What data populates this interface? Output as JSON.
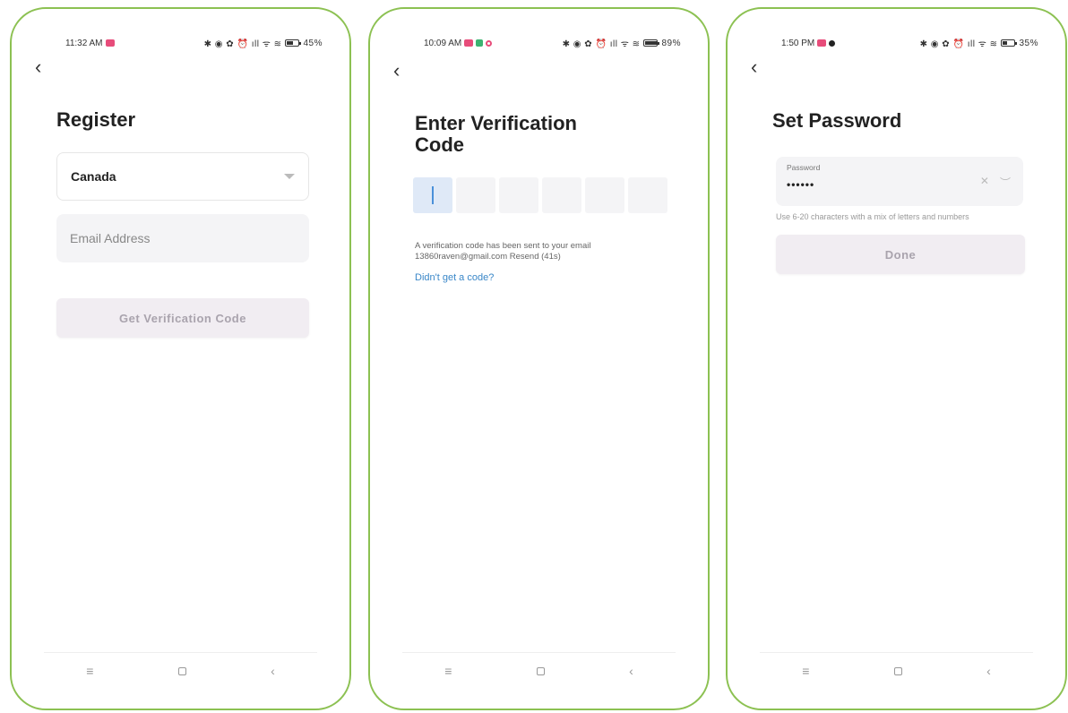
{
  "register": {
    "time": "11:32 AM",
    "battery": "45%",
    "battery_level": 0.45,
    "title": "Register",
    "country": "Canada",
    "email_placeholder": "Email Address",
    "button": "Get Verification Code"
  },
  "verify": {
    "time": "10:09 AM",
    "battery": "89%",
    "battery_level": 0.89,
    "title_line1": "Enter Verification",
    "title_line2": "Code",
    "info_line1": "A verification code has been sent to your email",
    "info_line2": "13860raven@gmail.com Resend (41s)",
    "link": "Didn't get a code?"
  },
  "password": {
    "time": "1:50 PM",
    "battery": "35%",
    "battery_level": 0.35,
    "title": "Set Password",
    "label": "Password",
    "value": "••••••",
    "hint": "Use 6-20 characters with a mix of letters and numbers",
    "button": "Done"
  },
  "status_icons": "✱ ◉ ✿ ⏰ ıll ᯤ ≋",
  "nav": {
    "menu": "≡",
    "back": "‹"
  },
  "colors": {
    "frame": "#8cc152",
    "link": "#3a87c8",
    "button_bg": "#f1edf2"
  }
}
